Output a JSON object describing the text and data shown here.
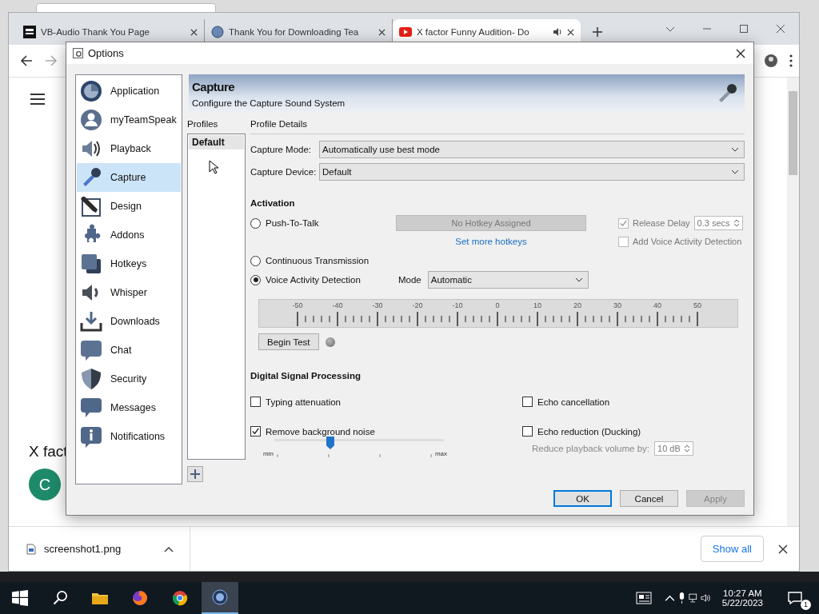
{
  "browser": {
    "tabs": [
      {
        "title": "VB-Audio Thank You Page",
        "selected": false,
        "audio": false
      },
      {
        "title": "Thank You for Downloading Tea",
        "selected": false,
        "audio": false
      },
      {
        "title": "X factor Funny Audition- Do",
        "selected": true,
        "audio": true
      }
    ],
    "page": {
      "heading": "X fact",
      "channel_initial": "C"
    },
    "downloads": {
      "file": "screenshot1.png",
      "show_all": "Show all"
    }
  },
  "dialog": {
    "title": "Options",
    "nav": [
      {
        "label": "Application",
        "selected": false
      },
      {
        "label": "myTeamSpeak",
        "selected": false
      },
      {
        "label": "Playback",
        "selected": false
      },
      {
        "label": "Capture",
        "selected": true
      },
      {
        "label": "Design",
        "selected": false
      },
      {
        "label": "Addons",
        "selected": false
      },
      {
        "label": "Hotkeys",
        "selected": false
      },
      {
        "label": "Whisper",
        "selected": false
      },
      {
        "label": "Downloads",
        "selected": false
      },
      {
        "label": "Chat",
        "selected": false
      },
      {
        "label": "Security",
        "selected": false
      },
      {
        "label": "Messages",
        "selected": false
      },
      {
        "label": "Notifications",
        "selected": false
      }
    ],
    "header": {
      "title": "Capture",
      "subtitle": "Configure the Capture Sound System"
    },
    "profiles": {
      "label": "Profiles",
      "items": [
        {
          "label": "Default",
          "selected": true
        }
      ]
    },
    "details": {
      "label": "Profile Details",
      "fields": [
        {
          "label": "Capture Mode:",
          "value": "Automatically use best mode"
        },
        {
          "label": "Capture Device:",
          "value": "Default"
        }
      ],
      "activation": {
        "heading": "Activation",
        "modes": [
          {
            "label": "Push-To-Talk",
            "selected": false
          },
          {
            "label": "Continuous Transmission",
            "selected": false
          },
          {
            "label": "Voice Activity Detection",
            "selected": true
          }
        ],
        "hotkey": {
          "label": "No Hotkey Assigned",
          "disabled": true
        },
        "hotkeys_link": "Set more hotkeys",
        "release_delay": {
          "label": "Release Delay",
          "checked": true,
          "disabled": true,
          "value": "0.3 secs"
        },
        "add_vad": {
          "label": "Add Voice Activity Detection",
          "checked": false,
          "disabled": true
        },
        "vad_mode": {
          "label": "Mode",
          "value": "Automatic"
        }
      },
      "meter": {
        "scale": [
          "-50",
          "-40",
          "-30",
          "-20",
          "-10",
          "0",
          "10",
          "20",
          "30",
          "40",
          "50"
        ],
        "test_button": "Begin Test"
      },
      "dsp": {
        "heading": "Digital Signal Processing",
        "left": [
          {
            "label": "Typing attenuation",
            "checked": false
          },
          {
            "label": "Remove background noise",
            "checked": true,
            "slider": {
              "level": 0.33,
              "min": "min",
              "max": "max"
            }
          }
        ],
        "right": [
          {
            "label": "Echo cancellation",
            "checked": false
          },
          {
            "label": "Echo reduction (Ducking)",
            "checked": false,
            "sub": {
              "label": "Reduce playback volume by:",
              "value": "10 dB",
              "disabled": true
            }
          }
        ]
      }
    },
    "buttons": [
      {
        "label": "OK",
        "default": true,
        "disabled": false
      },
      {
        "label": "Cancel",
        "default": false,
        "disabled": false
      },
      {
        "label": "Apply",
        "default": false,
        "disabled": true
      }
    ]
  },
  "taskbar": {
    "time": "10:27 AM",
    "date": "5/22/2023",
    "notification_count": "1"
  }
}
